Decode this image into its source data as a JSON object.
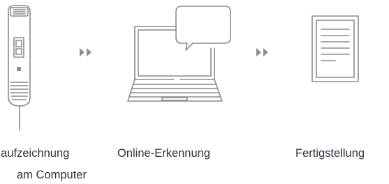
{
  "steps": [
    {
      "caption_lines": [
        "haufzeichnung",
        "am Computer"
      ],
      "icon": "dictation-microphone-icon"
    },
    {
      "caption_lines": [
        "Online-Erkennung"
      ],
      "icon": "laptop-speech-bubble-icon"
    },
    {
      "caption_lines": [
        "Fertigstellung"
      ],
      "icon": "document-icon"
    }
  ],
  "colors": {
    "line": "#8c8c8c",
    "text": "#2d3340",
    "background": "#ffffff"
  }
}
